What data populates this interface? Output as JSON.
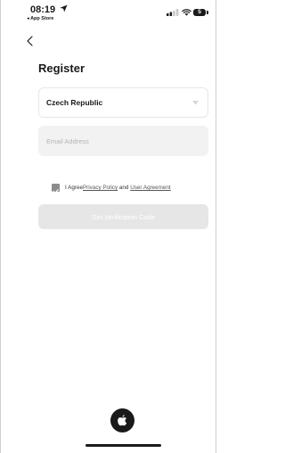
{
  "status_bar": {
    "time": "08:19",
    "back_app": "◂ App Store",
    "battery": "5"
  },
  "page": {
    "title": "Register"
  },
  "form": {
    "country": "Czech Republic",
    "email_placeholder": "Email Address",
    "email_value": "",
    "agree_prefix": "I Agree",
    "privacy_link": "Privacy Policy",
    "and_text": " and ",
    "user_agreement_link": "User Agreement",
    "checkbox_checked": true,
    "submit_label": "Get Verification Code"
  },
  "colors": {
    "primary_text": "#1a1a1a",
    "field_bg": "#f2f2f2",
    "button_disabled_bg": "#e6e6e6",
    "checkbox": "#8c8c8c"
  },
  "icons": [
    "location-arrow-icon",
    "signal-icon",
    "wifi-icon",
    "battery-icon",
    "back-chevron-icon",
    "chevron-down-icon",
    "checkmark-icon",
    "apple-logo-icon"
  ]
}
